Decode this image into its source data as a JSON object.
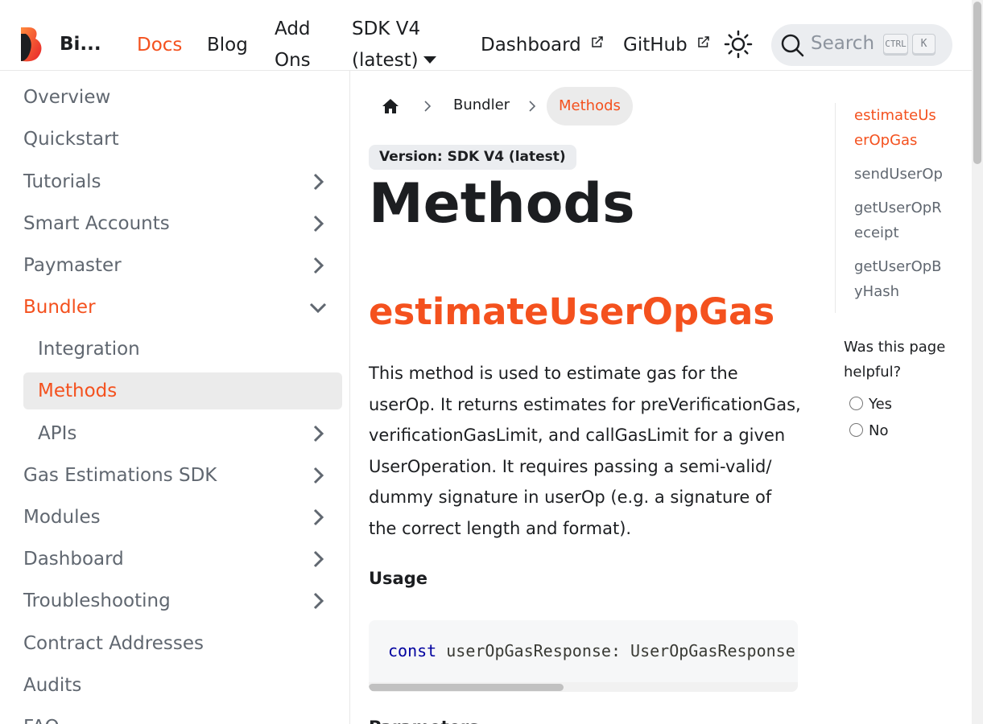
{
  "navbar": {
    "brand": "Bi...",
    "links": {
      "docs": "Docs",
      "blog": "Blog",
      "addons_line1": "Add",
      "addons_line2": "Ons",
      "sdk_line1": "SDK V4",
      "sdk_line2": "(latest)",
      "dashboard": "Dashboard",
      "github": "GitHub"
    },
    "search": {
      "placeholder": "Search",
      "key1": "CTRL",
      "key2": "K"
    },
    "accent_color": "#f4511e"
  },
  "sidebar": {
    "items": [
      {
        "label": "Overview"
      },
      {
        "label": "Quickstart"
      },
      {
        "label": "Tutorials"
      },
      {
        "label": "Smart Accounts"
      },
      {
        "label": "Paymaster"
      },
      {
        "label": "Bundler"
      },
      {
        "label": "Integration"
      },
      {
        "label": "Methods"
      },
      {
        "label": "APIs"
      },
      {
        "label": "Gas Estimations SDK"
      },
      {
        "label": "Modules"
      },
      {
        "label": "Dashboard"
      },
      {
        "label": "Troubleshooting"
      },
      {
        "label": "Contract Addresses"
      },
      {
        "label": "Audits"
      },
      {
        "label": "FAQ"
      }
    ]
  },
  "breadcrumbs": {
    "home_icon": "home-icon",
    "items": [
      "Bundler",
      "Methods"
    ]
  },
  "main": {
    "version_badge": "Version: SDK V4 (latest)",
    "title": "Methods",
    "section_title": "estimateUserOpGas",
    "paragraph": "This method is used to estimate gas for the userOp. It returns estimates for preVerificationGas, verificationGasLimit, and callGasLimit for a given UserOperation. It requires passing a semi-valid/ dummy signature in userOp (e.g. a signature of the correct length and format).",
    "usage_heading": "Usage",
    "code": {
      "keyword": "const",
      "rest": " userOpGasResponse: UserOpGasResponse = await bundler.estimateUserOpGas(userOp);"
    },
    "next_heading": "Parameters"
  },
  "toc": {
    "items": [
      {
        "label": "estimateUserOpGas"
      },
      {
        "label": "sendUserOp"
      },
      {
        "label": "getUserOpReceipt"
      },
      {
        "label": "getUserOpByHash"
      }
    ]
  },
  "feedback": {
    "question": "Was this page helpful?",
    "yes": "Yes",
    "no": "No"
  }
}
